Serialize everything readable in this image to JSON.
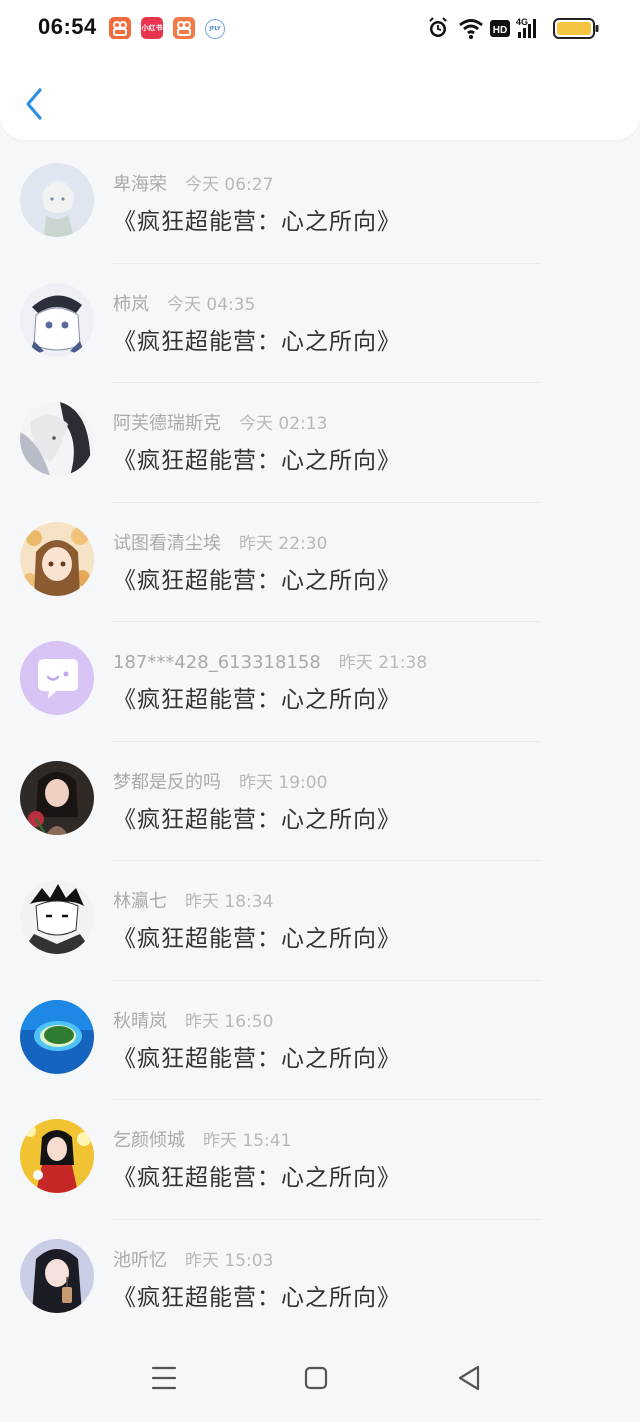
{
  "status_bar": {
    "time": "06:54",
    "app_icons": [
      {
        "name": "kuaishou-icon",
        "color": "#f36b3a",
        "label": "⌂"
      },
      {
        "name": "mini-app-icon",
        "color": "#e8344e",
        "label": "小红书"
      },
      {
        "name": "kuaishou-icon-2",
        "color": "#f37a48",
        "label": "⌂"
      },
      {
        "name": "jfly-icon",
        "color": "#ffffff",
        "label": "JFLY"
      }
    ],
    "network": "4G",
    "hd": "HD",
    "battery_level": 0.95,
    "battery_color": "#f5c542"
  },
  "header": {
    "back_icon": "chevron-left-icon",
    "accent": "#2e8fe6"
  },
  "messages": [
    {
      "name": "卑海荣",
      "time": "今天 06:27",
      "text": "《疯狂超能营：心之所向》",
      "avatar": "anime-boy-white-hair"
    },
    {
      "name": "柿岚",
      "time": "今天 04:35",
      "text": "《疯狂超能营：心之所向》",
      "avatar": "anime-girl-hat"
    },
    {
      "name": "阿芙德瑞斯克",
      "time": "今天 02:13",
      "text": "《疯狂超能营：心之所向》",
      "avatar": "anime-girl-dark-hair"
    },
    {
      "name": "试图看清尘埃",
      "time": "昨天 22:30",
      "text": "《疯狂超能营：心之所向》",
      "avatar": "anime-girl-flowers"
    },
    {
      "name": "187***428_613318158",
      "time": "昨天 21:38",
      "text": "《疯狂超能营：心之所向》",
      "avatar": "default-chat-bubble"
    },
    {
      "name": "梦都是反的吗",
      "time": "昨天 19:00",
      "text": "《疯狂超能营：心之所向》",
      "avatar": "photo-girl-rose"
    },
    {
      "name": "林瀛七",
      "time": "昨天 18:34",
      "text": "《疯狂超能营：心之所向》",
      "avatar": "anime-boy-monochrome"
    },
    {
      "name": "秋晴岚",
      "time": "昨天 16:50",
      "text": "《疯狂超能营：心之所向》",
      "avatar": "island-ocean"
    },
    {
      "name": "乞颜倾城",
      "time": "昨天 15:41",
      "text": "《疯狂超能营：心之所向》",
      "avatar": "ancient-costume-girl"
    },
    {
      "name": "池听忆",
      "time": "昨天 15:03",
      "text": "《疯狂超能营：心之所向》",
      "avatar": "photo-girl-drink"
    }
  ],
  "nav_bar": {
    "menu_icon": "menu-icon",
    "home_icon": "home-square-icon",
    "back_icon": "back-triangle-icon"
  }
}
